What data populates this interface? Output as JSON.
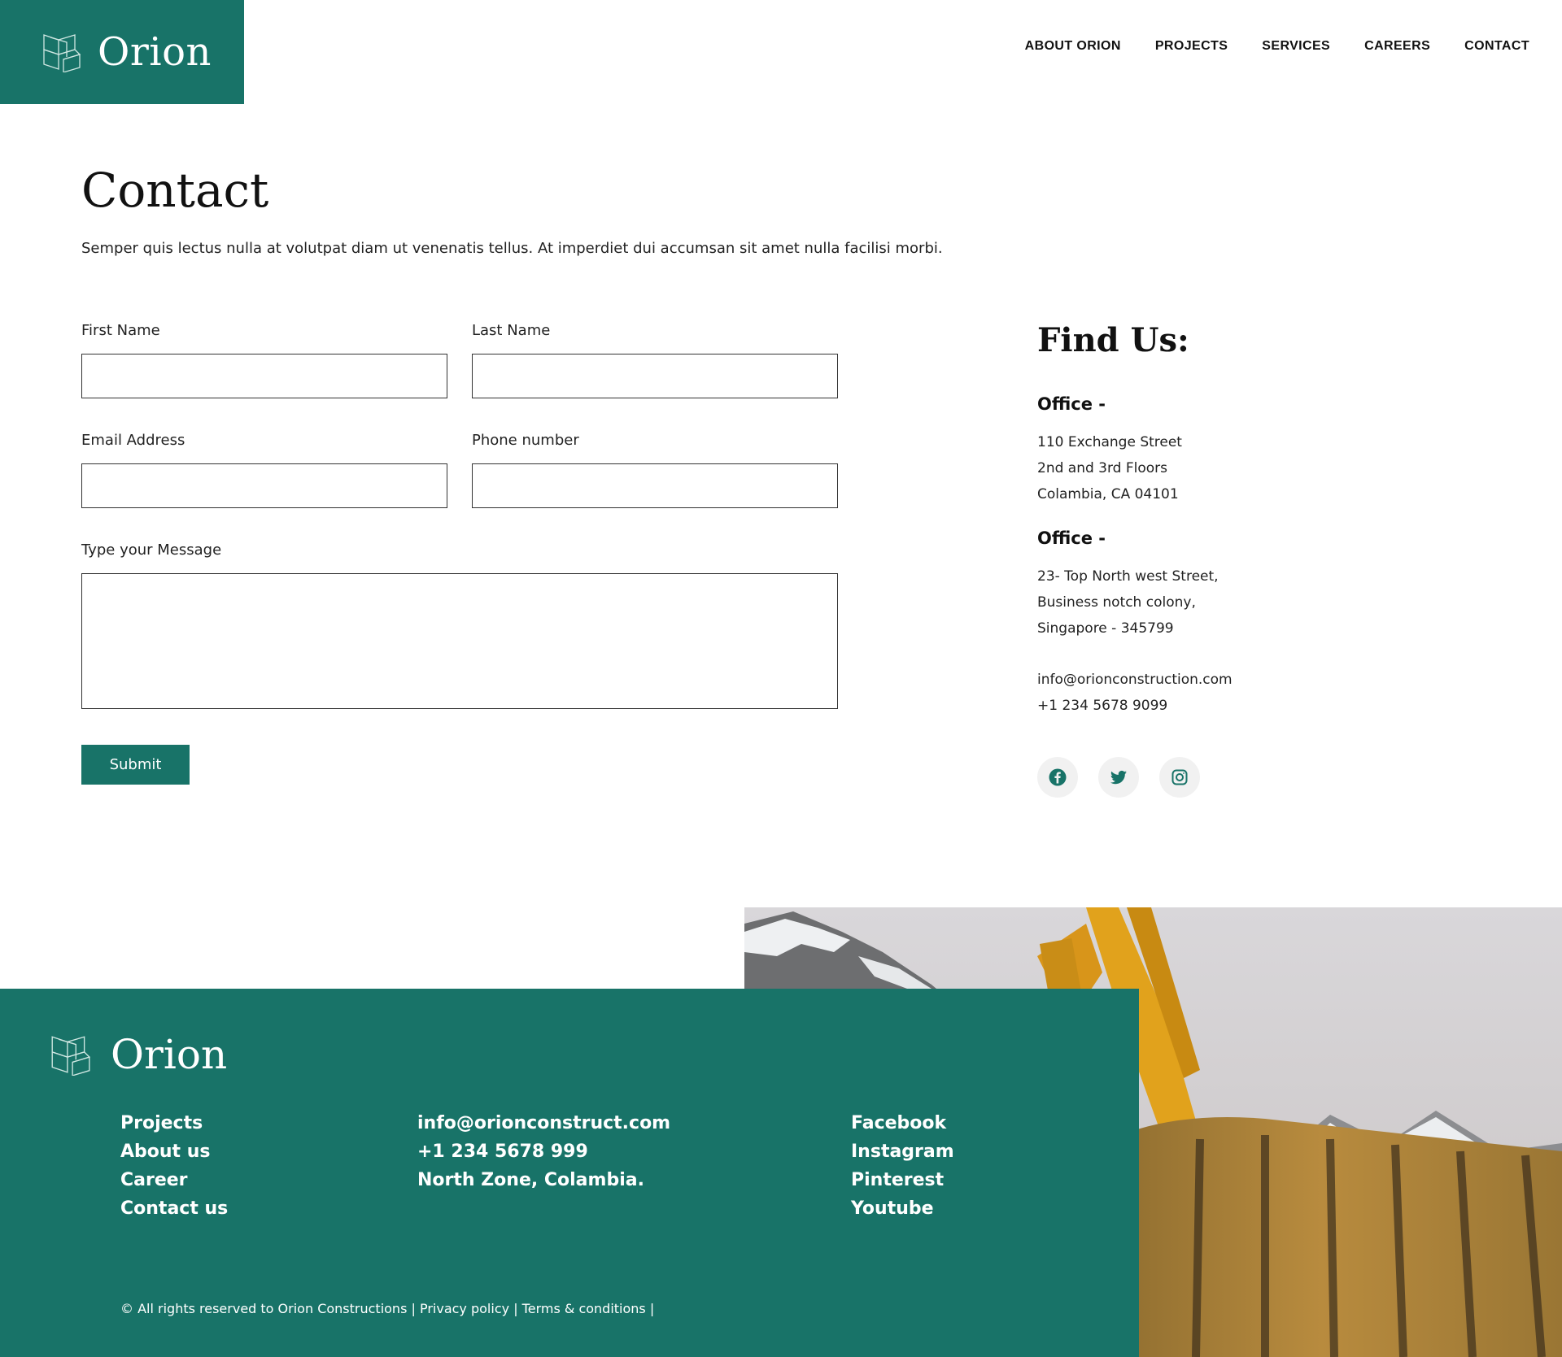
{
  "brand": {
    "name": "Orion",
    "accent": "#187368"
  },
  "nav": {
    "items": [
      "ABOUT ORION",
      "PROJECTS",
      "SERVICES",
      "CAREERS",
      "CONTACT"
    ]
  },
  "intro": {
    "title": "Contact",
    "subtitle": "Semper quis lectus nulla at volutpat diam ut venenatis tellus. At imperdiet dui accumsan sit amet nulla facilisi morbi."
  },
  "form": {
    "first_name_label": "First Name",
    "last_name_label": "Last Name",
    "email_label": "Email Address",
    "phone_label": "Phone number",
    "message_label": "Type your Message",
    "submit_label": "Submit"
  },
  "find_us": {
    "title": "Find Us:",
    "offices": [
      {
        "heading": "Office -",
        "lines": [
          "110 Exchange Street",
          "2nd and 3rd Floors",
          "Colambia, CA 04101"
        ]
      },
      {
        "heading": "Office -",
        "lines": [
          "23- Top North west Street,",
          "Business notch colony,",
          "Singapore - 345799"
        ]
      }
    ],
    "email": "info@orionconstruction.com",
    "phone": "+1 234 5678 9099",
    "social_icons": [
      "facebook-icon",
      "twitter-icon",
      "instagram-icon"
    ]
  },
  "footer": {
    "brand": "Orion",
    "links": [
      "Projects",
      "About us",
      "Career",
      "Contact us"
    ],
    "contact": [
      "info@orionconstruct.com",
      "+1 234 5678 999",
      "North Zone, Colambia."
    ],
    "social": [
      "Facebook",
      "Instagram",
      "Pinterest",
      "Youtube"
    ],
    "copyright": "© All rights reserved to Orion Constructions |",
    "privacy": "Privacy policy",
    "terms": "Terms & conditions",
    "sep": "|",
    "sep_end": "|"
  }
}
